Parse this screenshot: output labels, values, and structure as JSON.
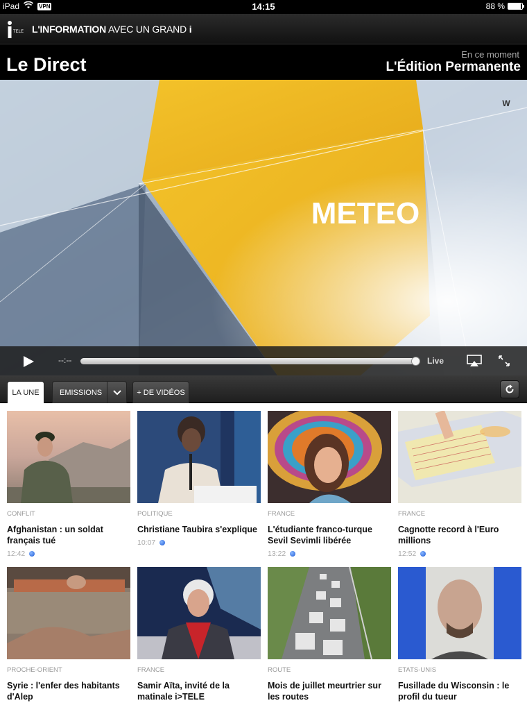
{
  "status_bar": {
    "device": "iPad",
    "vpn": "VPN",
    "time": "14:15",
    "battery": "88 %",
    "battery_level": 0.88
  },
  "brand": {
    "logo_text": "TELE",
    "tagline_bold": "L'INFORMATION",
    "tagline_rest": "AVEC UN GRAND",
    "tagline_mark": "i"
  },
  "title_bar": {
    "title": "Le Direct",
    "now_label": "En ce moment",
    "now_program": "L'Édition Permanente"
  },
  "video": {
    "on_screen_text": "METEO",
    "corner_mark": "W",
    "time": "--:--",
    "live_label": "Live",
    "progress": 1.0
  },
  "tabs": {
    "la_une": "LA UNE",
    "emissions": "EMISSIONS",
    "videos": "+ DE VIDÉOS",
    "active": "la_une"
  },
  "articles": [
    {
      "category": "CONFLIT",
      "headline": "Afghanistan : un soldat français tué",
      "time": "12:42"
    },
    {
      "category": "POLITIQUE",
      "headline": "Christiane Taubira s'explique",
      "time": "10:07"
    },
    {
      "category": "FRANCE",
      "headline": "L'étudiante franco-turque Sevil Sevimli libérée",
      "time": "13:22"
    },
    {
      "category": "FRANCE",
      "headline": "Cagnotte record à l'Euro millions",
      "time": "12:52"
    },
    {
      "category": "PROCHE-ORIENT",
      "headline": "Syrie : l'enfer des habitants d'Alep",
      "time": ""
    },
    {
      "category": "FRANCE",
      "headline": "Samir Aïta, invité de la matinale i>TELE",
      "time": ""
    },
    {
      "category": "ROUTE",
      "headline": "Mois de juillet meurtrier sur les routes",
      "time": ""
    },
    {
      "category": "ETATS-UNIS",
      "headline": "Fusillade du Wisconsin : le profil du tueur",
      "time": ""
    }
  ]
}
